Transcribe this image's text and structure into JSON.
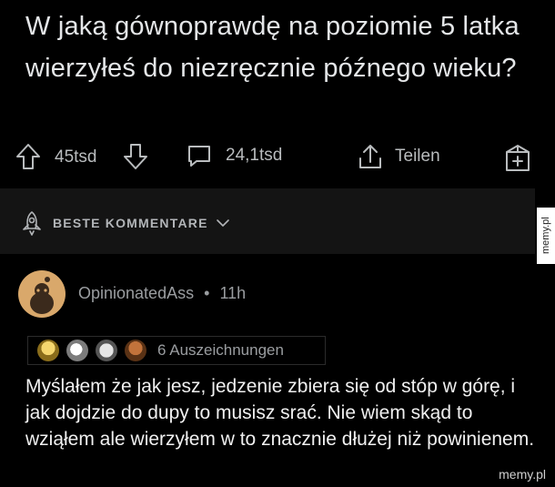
{
  "post": {
    "title": "W jaką gównoprawdę na poziomie 5 latka wierzyłeś do niezręcznie późnego wieku?",
    "upvotes": "45tsd",
    "comments": "24,1tsd",
    "share_label": "Teilen"
  },
  "sort": {
    "label": "BESTE KOMMENTARE"
  },
  "comment": {
    "author": "OpinionatedAss",
    "time": "11h",
    "awards_count": "6 Auszeichnungen",
    "text": "Myślałem że jak jesz, jedzenie zbiera się od stóp w górę, i jak dojdzie do dupy to musisz srać. Nie wiem skąd to wziąłem ale wierzyłem w to znacznie dłużej niż powinienem."
  },
  "watermarks": {
    "side": "memy.pl",
    "corner": "memy.pl"
  },
  "colors": {
    "background": "#000000",
    "band": "#141414",
    "text_primary": "#e4e6e8",
    "text_muted": "#9a9da0",
    "avatar": "#d9a86b"
  }
}
